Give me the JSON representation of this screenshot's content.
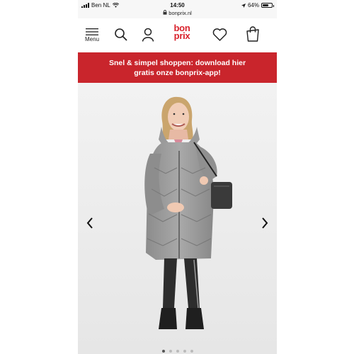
{
  "status_bar": {
    "carrier": "Ben NL",
    "time": "14:50",
    "url": "bonprix.nl",
    "battery": "64%",
    "battery_level": 0.64
  },
  "header": {
    "menu_label": "Menu",
    "logo_top": "bon",
    "logo_bottom": "prix",
    "icons": [
      "menu-icon",
      "search-icon",
      "account-icon",
      "wishlist-icon",
      "cart-icon"
    ],
    "brand_color": "#d9232d"
  },
  "promo": {
    "line1": "Snel & simpel shoppen: download hier",
    "line2": "gratis onze bonprix-app!",
    "background": "#c9252c"
  },
  "gallery": {
    "prev_icon": "chevron-left-icon",
    "next_icon": "chevron-right-icon",
    "dots_count": 5,
    "active_dot": 1
  }
}
